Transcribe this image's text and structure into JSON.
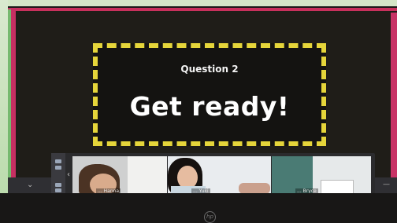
{
  "slide": {
    "question_label": "Question 2",
    "headline": "Get ready!"
  },
  "gallery": {
    "participants": [
      {
        "name": "... Hanna"
      },
      {
        "name": "... Yuki"
      },
      {
        "name": "... Bryce"
      }
    ]
  },
  "colors": {
    "banner_border": "#e5d53a",
    "slide_background": "#1f1d18",
    "pink_edge": "#c62f62",
    "green_edge": "#76b96f"
  },
  "icons": {
    "prev_arrow": "chevron-left-icon",
    "toolbar_chevron": "chevron-down-icon",
    "laptop_logo": "hp-logo"
  }
}
